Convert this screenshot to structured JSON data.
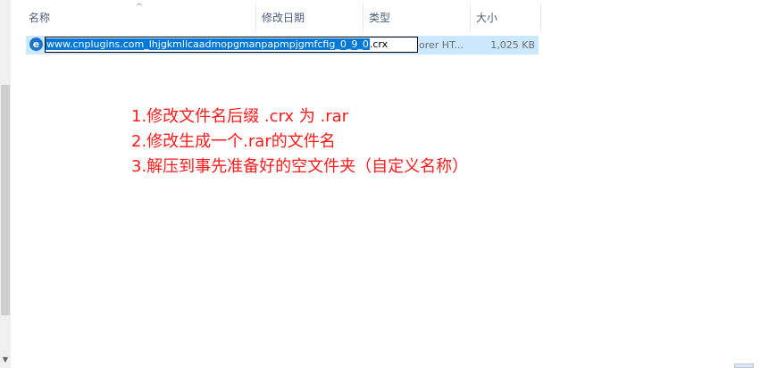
{
  "columns": {
    "name": "名称",
    "modified": "修改日期",
    "type": "类型",
    "size": "大小"
  },
  "sort_indicator": "^",
  "file": {
    "name_selected": "www.cnplugins.com_lhjgkmllcaadmopgmanpapmpjgmfcfig_0_9_0",
    "extension": ".crx",
    "type": "orer HT...",
    "size": "1,025 KB",
    "icon": "ie-icon"
  },
  "instructions": [
    "1.修改文件名后缀 .crx 为 .rar",
    "2.修改生成一个.rar的文件名",
    "3.解压到事先准备好的空文件夹（自定义名称）"
  ],
  "colors": {
    "selection": "#cce8ff",
    "highlight": "#0078d7",
    "annotation": "#ff1a1a"
  }
}
